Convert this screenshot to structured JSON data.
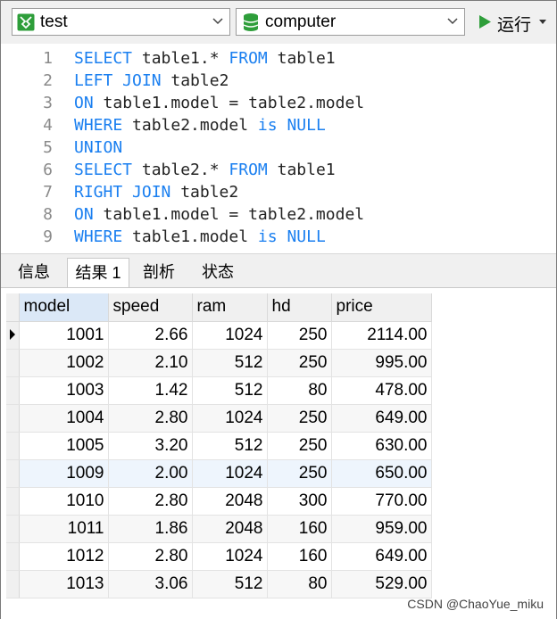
{
  "toolbar": {
    "connection": "test",
    "database": "computer",
    "run_label": "运行",
    "colors": {
      "connection_icon": "#2e9e3a",
      "database_icon": "#2e9e3a",
      "run_icon": "#2e9e3a"
    }
  },
  "editor": {
    "lines": [
      {
        "n": "1",
        "kw1": "SELECT",
        "t1": " table1.* ",
        "kw2": "FROM",
        "t2": " table1",
        "kw3": "",
        "t3": ""
      },
      {
        "n": "2",
        "kw1": "LEFT JOIN",
        "t1": " table2",
        "kw2": "",
        "t2": "",
        "kw3": "",
        "t3": ""
      },
      {
        "n": "3",
        "kw1": "ON",
        "t1": " table1.model = table2.model",
        "kw2": "",
        "t2": "",
        "kw3": "",
        "t3": ""
      },
      {
        "n": "4",
        "kw1": "WHERE",
        "t1": " table2.model ",
        "kw2": "is",
        "t2": " ",
        "kw3": "NULL",
        "t3": ""
      },
      {
        "n": "5",
        "kw1": "UNION",
        "t1": "",
        "kw2": "",
        "t2": "",
        "kw3": "",
        "t3": ""
      },
      {
        "n": "6",
        "kw1": "SELECT",
        "t1": " table2.* ",
        "kw2": "FROM",
        "t2": " table1",
        "kw3": "",
        "t3": ""
      },
      {
        "n": "7",
        "kw1": "RIGHT JOIN",
        "t1": " table2",
        "kw2": "",
        "t2": "",
        "kw3": "",
        "t3": ""
      },
      {
        "n": "8",
        "kw1": "ON",
        "t1": " table1.model = table2.model",
        "kw2": "",
        "t2": "",
        "kw3": "",
        "t3": ""
      },
      {
        "n": "9",
        "kw1": "WHERE",
        "t1": " table1.model ",
        "kw2": "is",
        "t2": " ",
        "kw3": "NULL",
        "t3": ""
      }
    ]
  },
  "tabs": [
    {
      "label": "信息"
    },
    {
      "label": "结果 1"
    },
    {
      "label": "剖析"
    },
    {
      "label": "状态"
    }
  ],
  "grid": {
    "columns": [
      "model",
      "speed",
      "ram",
      "hd",
      "price"
    ],
    "rows": [
      [
        "1001",
        "2.66",
        "1024",
        "250",
        "2114.00"
      ],
      [
        "1002",
        "2.10",
        "512",
        "250",
        "995.00"
      ],
      [
        "1003",
        "1.42",
        "512",
        "80",
        "478.00"
      ],
      [
        "1004",
        "2.80",
        "1024",
        "250",
        "649.00"
      ],
      [
        "1005",
        "3.20",
        "512",
        "250",
        "630.00"
      ],
      [
        "1009",
        "2.00",
        "1024",
        "250",
        "650.00"
      ],
      [
        "1010",
        "2.80",
        "2048",
        "300",
        "770.00"
      ],
      [
        "1011",
        "1.86",
        "2048",
        "160",
        "959.00"
      ],
      [
        "1012",
        "2.80",
        "1024",
        "160",
        "649.00"
      ],
      [
        "1013",
        "3.06",
        "512",
        "80",
        "529.00"
      ]
    ]
  },
  "watermark": "CSDN @ChaoYue_miku"
}
